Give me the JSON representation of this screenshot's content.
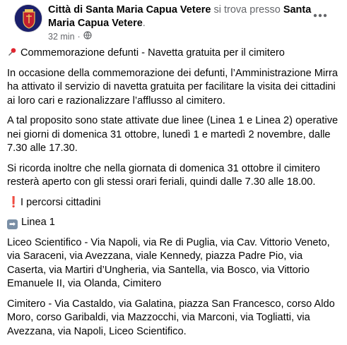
{
  "header": {
    "page_name": "Città di Santa Maria Capua Vetere",
    "connector": " si trova presso ",
    "location": "Santa Maria Capua Vetere",
    "period": ".",
    "time": "32 min",
    "separator": "·",
    "audience_icon": "globe-icon",
    "more_icon": "more-options-icon"
  },
  "post": {
    "title": "Commemorazione defunti - Navetta gratuita per il cimitero",
    "title_icon": "pushpin-icon",
    "p1": "In occasione della commemorazione dei defunti, l’Amministrazione Mirra ha attivato il servizio di navetta gratuita per facilitare la visita dei cittadini ai loro cari e razionalizzare l’afflusso al cimitero.",
    "p2": "A tal proposito sono state attivate due linee (Linea 1 e Linea 2) operative nei giorni di domenica 31 ottobre, lunedì 1 e martedì 2 novembre, dalle 7.30 alle 17.30.",
    "p3": "Si ricorda inoltre che nella giornata di domenica 31 ottobre il cimitero resterà aperto con gli stessi orari feriali, quindi dalle 7.30 alle 18.00.",
    "routes_heading": "I percorsi cittadini",
    "routes_icon": "exclamation-icon",
    "line_label": "Linea 1",
    "line_icon": "right-arrow-icon",
    "route_out": "Liceo Scientifico - Via Napoli, via Re di Puglia, via Cav. Vittorio Veneto, via Saraceni, via Avezzana, viale Kennedy, piazza Padre Pio, via Caserta, via Martiri d’Ungheria, via Santella, via Bosco, via Vittorio Emanuele II, via Olanda, Cimitero",
    "route_back": "Cimitero - Via Castaldo, via Galatina, piazza San Francesco, corso Aldo Moro, corso Garibaldi, via Mazzocchi, via Marconi, via Togliatti, via Avezzana, via Napoli, Liceo Scientifico."
  },
  "colors": {
    "text": "#050505",
    "muted": "#65676b",
    "avatar_bg": "#1b1f6b",
    "accent_red": "#e11d2b"
  }
}
